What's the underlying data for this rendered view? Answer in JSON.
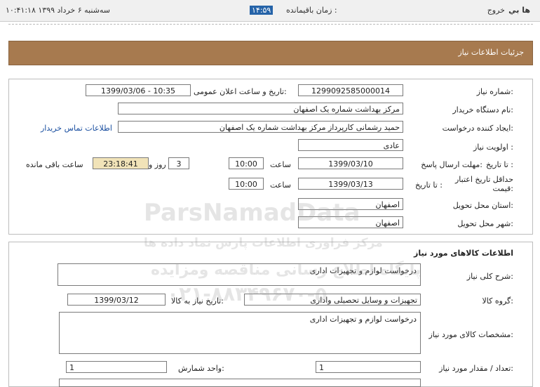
{
  "topbar": {
    "app_name": "ها بي",
    "logout": "خروج",
    "remaining_label": "زمان باقيمانده :",
    "remaining_time": "۱۴:۵۹",
    "datetime": "سه‌شنبه ۶ خرداد ۱۳۹۹   ۱۰:۴۱:۱۸"
  },
  "header": {
    "title": "جزئیات اطلاعات نیاز"
  },
  "form": {
    "need_number_label": "شماره نیاز:",
    "need_number": "1299092585000014",
    "announce_label": "تاریخ و ساعت اعلان عمومی:",
    "announce_value": "1399/03/06 - 10:35",
    "buyer_org_label": "نام دستگاه خریدار:",
    "buyer_org": "مرکز بهداشت شماره یک اصفهان",
    "creator_label": "ایجاد کننده درخواست:",
    "creator": "حمید رشمانی کارپرداز مرکز بهداشت شماره یک اصفهان",
    "contact_link": "اطلاعات تماس خریدار",
    "priority_label": "اولویت نیاز :",
    "priority": "عادی",
    "deadline_label": "مهلت ارسال پاسخ:",
    "until_date_label": "تا تاریخ :",
    "deadline_date": "1399/03/10",
    "time_label": "ساعت",
    "deadline_time": "10:00",
    "days": "3",
    "days_and_label": "روز و",
    "remain_time": "23:18:41",
    "remain_label": "ساعت باقی مانده",
    "validity_label": "حداقل تاریخ اعتبار قیمت:",
    "validity_until_label": "تا تاریخ :",
    "validity_date": "1399/03/13",
    "validity_time_label": "ساعت",
    "validity_time": "10:00",
    "province_label": "استان محل تحویل:",
    "province": "اصفهان",
    "city_label": "شهر محل تحویل:",
    "city": "اصفهان"
  },
  "goods": {
    "section_title": "اطلاعات کالاهای مورد نیاز",
    "summary_label": "شرح کلی نیاز:",
    "summary": "درخواست لوازم و تجهیزات اداری",
    "group_label": "گروه کالا:",
    "group": "تجهیزات و وسایل تحصیلی واداری",
    "need_date_label": "تاریخ نیاز به کالا:",
    "need_date": "1399/03/12",
    "specs_label": "مشخصات کالای مورد نیاز:",
    "specs": "درخواست لوازم و تجهیزات اداری",
    "qty_label": "تعداد / مقدار مورد نیاز:",
    "qty": "1",
    "unit_label": "واحد شمارش:",
    "unit": "1"
  },
  "watermark": {
    "brand_en": "ParsNamadData",
    "brand_fa": "مرکز فراوری اطلاعات پارس نماد داده ها",
    "subtitle": "پایگاه اطلاع رسانی مناقصه ومزایده",
    "phone": "۰۲۱-۸۸۳۴۹۶۷۰-۵"
  }
}
